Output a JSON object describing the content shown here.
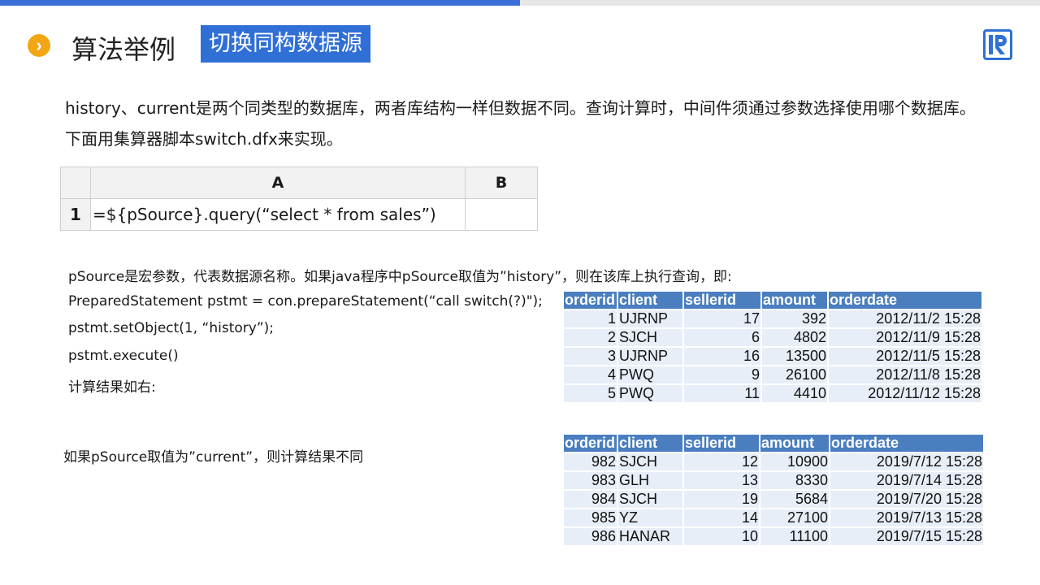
{
  "header": {
    "title": "算法举例",
    "subtitle": "切换同构数据源"
  },
  "intro": "history、current是两个同类型的数据库，两者库结构一样但数据不同。查询计算时，中间件须通过参数选择使用哪个数据库。下面用集算器脚本switch.dfx来实现。",
  "grid": {
    "col_a": "A",
    "col_b": "B",
    "row_num": "1",
    "formula": "=${pSource}.query(“select * from sales”)",
    "b_value": ""
  },
  "desc": {
    "line1": "pSource是宏参数，代表数据源名称。如果java程序中pSource取值为”history”，则在该库上执行查询，即:",
    "line2": "PreparedStatement pstmt = con.prepareStatement(“call switch(?)\");",
    "line3": "pstmt.setObject(1, “history”);",
    "line4": "pstmt.execute()",
    "line5": "计算结果如右:",
    "line6": "如果pSource取值为”current”，则计算结果不同"
  },
  "table_history": {
    "columns": [
      "orderid",
      "client",
      "sellerid",
      "amount",
      "orderdate"
    ],
    "rows": [
      [
        "1",
        "UJRNP",
        "17",
        "392",
        "2012/11/2 15:28"
      ],
      [
        "2",
        "SJCH",
        "6",
        "4802",
        "2012/11/9 15:28"
      ],
      [
        "3",
        "UJRNP",
        "16",
        "13500",
        "2012/11/5 15:28"
      ],
      [
        "4",
        "PWQ",
        "9",
        "26100",
        "2012/11/8 15:28"
      ],
      [
        "5",
        "PWQ",
        "11",
        "4410",
        "2012/11/12 15:28"
      ]
    ]
  },
  "table_current": {
    "columns": [
      "orderid",
      "client",
      "sellerid",
      "amount",
      "orderdate"
    ],
    "rows": [
      [
        "982",
        "SJCH",
        "12",
        "10900",
        "2019/7/12 15:28"
      ],
      [
        "983",
        "GLH",
        "13",
        "8330",
        "2019/7/14 15:28"
      ],
      [
        "984",
        "SJCH",
        "19",
        "5684",
        "2019/7/20 15:28"
      ],
      [
        "985",
        "YZ",
        "14",
        "27100",
        "2019/7/13 15:28"
      ],
      [
        "986",
        "HANAR",
        "10",
        "11100",
        "2019/7/15 15:28"
      ]
    ]
  },
  "colors": {
    "accent_blue": "#2f6fd6",
    "bullet_orange": "#f3a614",
    "table_header": "#4a7ebf",
    "table_row": "#e8eef7"
  }
}
